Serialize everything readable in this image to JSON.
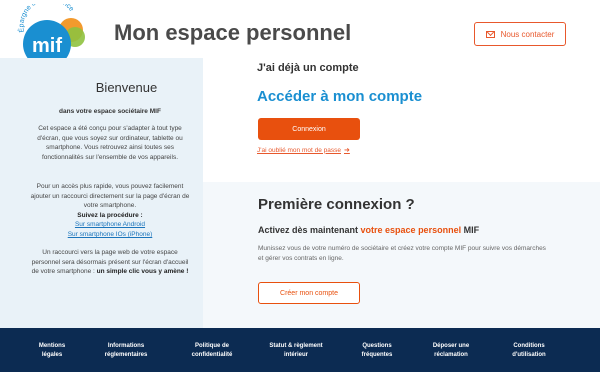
{
  "header": {
    "logo_text": "mif",
    "logo_tagline": "Épargne & prévoyance",
    "title": "Mon espace personnel",
    "contact_label": "Nous contacter"
  },
  "colors": {
    "brand_blue": "#1a8fd1",
    "accent_orange": "#e8500e",
    "footer_navy": "#0c2b52",
    "left_panel_bg": "#e9f2f8"
  },
  "left_panel": {
    "heading": "Bienvenue",
    "subheading": "dans votre espace sociétaire MIF",
    "intro": "Cet espace a été conçu pour s'adapter à tout type d'écran, que vous soyez sur ordinateur, tablette ou smartphone. Vous retrouvez ainsi toutes ses fonctionnalités sur l'ensemble de vos appareils.",
    "shortcut": "Pour un accès plus rapide, vous pouvez facilement ajouter un raccourci directement sur la page d'écran de votre smartphone.",
    "procedure_label": "Suivez la procédure :",
    "android_link": "Sur smartphone Android",
    "ios_link": "Sur smartphone IOs (iPhone)",
    "shortcut_note_1": "Un raccourci vers la page web de votre espace personnel sera désormais présent sur l'écran d'accueil de votre smartphone : ",
    "shortcut_note_bold": "un simple clic vous y amène !"
  },
  "login": {
    "has_account": "J'ai déjà un compte",
    "access_heading": "Accéder à mon compte",
    "login_button": "Connexion",
    "forgot_password": "J'ai oublié mon mot de passe"
  },
  "first_connection": {
    "heading": "Première connexion ?",
    "activate_prefix": "Activez dès maintenant ",
    "activate_highlight": "votre espace personnel",
    "activate_suffix": " MIF",
    "description": "Munissez vous de votre numéro de sociétaire et créez votre compte MIF pour suivre vos démarches et gérer vos contrats en ligne.",
    "create_button": "Créer mon compte"
  },
  "footer": {
    "links": [
      {
        "line1": "Mentions",
        "line2": "légales"
      },
      {
        "line1": "Informations",
        "line2": "réglementaires"
      },
      {
        "line1": "Politique de",
        "line2": "confidentialité"
      },
      {
        "line1": "Statut & règlement",
        "line2": "intérieur"
      },
      {
        "line1": "Questions",
        "line2": "fréquentes"
      },
      {
        "line1": "Déposer une",
        "line2": "réclamation"
      },
      {
        "line1": "Conditions",
        "line2": "d'utilisation"
      }
    ]
  }
}
